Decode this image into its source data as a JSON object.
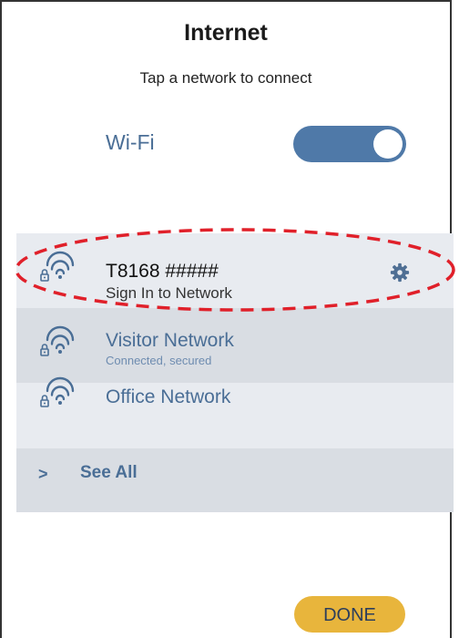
{
  "header": {
    "title": "Internet",
    "subtitle": "Tap a network to connect"
  },
  "wifi": {
    "label": "Wi-Fi",
    "enabled": true
  },
  "networks": [
    {
      "name": "T8168 #####",
      "status": "Sign In to Network",
      "secured": true,
      "icon": "wifi-locked-icon",
      "has_settings": true,
      "row_color": "#e8ebf0"
    },
    {
      "name": "Visitor Network",
      "status": "Connected, secured",
      "secured": true,
      "icon": "wifi-locked-icon",
      "row_color": "#d9dde3"
    },
    {
      "name": "Office Network",
      "status": "",
      "secured": true,
      "icon": "wifi-locked-icon",
      "row_color": "#e8ebf0"
    }
  ],
  "see_all": {
    "chevron": ">",
    "label": "See All",
    "row_color": "#d9dde3"
  },
  "done": {
    "label": "DONE"
  },
  "colors": {
    "accent": "#4a6e96",
    "toggle_on": "#4f79a8",
    "done_button": "#e8b53c",
    "highlight_dash": "#e0202a"
  }
}
